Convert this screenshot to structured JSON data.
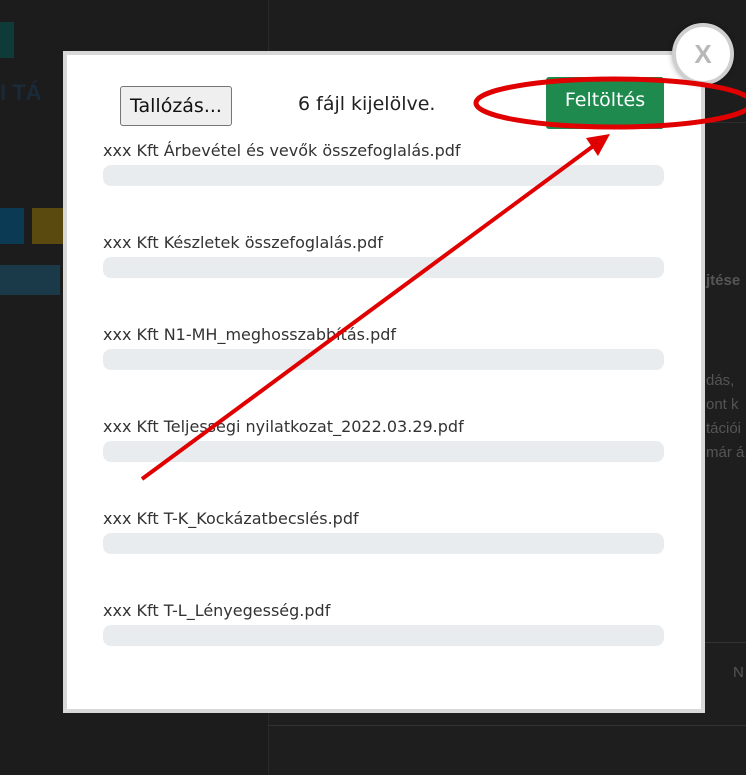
{
  "background": {
    "title": "I TÁ",
    "text_1": "jtése",
    "text_2": "dás, ",
    "text_3": "ont k",
    "text_4": "tációi",
    "text_5": "már á",
    "text_6": "N"
  },
  "dialog": {
    "close_label": "X",
    "browse_label": "Tallózás...",
    "selected_text": "6 fájl kijelölve.",
    "upload_label": "Feltöltés",
    "progress_fill_color": "#1e8a4e",
    "files": [
      {
        "name": "xxx Kft Árbevétel és vevők összefoglalás.pdf",
        "progress": 0
      },
      {
        "name": "xxx Kft Készletek összefoglalás.pdf",
        "progress": 0
      },
      {
        "name": "xxx Kft N1-MH_meghosszabbítás.pdf",
        "progress": 0
      },
      {
        "name": "xxx Kft Teljességi nyilatkozat_2022.03.29.pdf",
        "progress": 0
      },
      {
        "name": "xxx Kft T-K_Kockázatbecslés.pdf",
        "progress": 0
      },
      {
        "name": "xxx Kft T-L_Lényegesség.pdf",
        "progress": 0
      }
    ]
  },
  "annotation": {
    "color": "#e00000"
  }
}
